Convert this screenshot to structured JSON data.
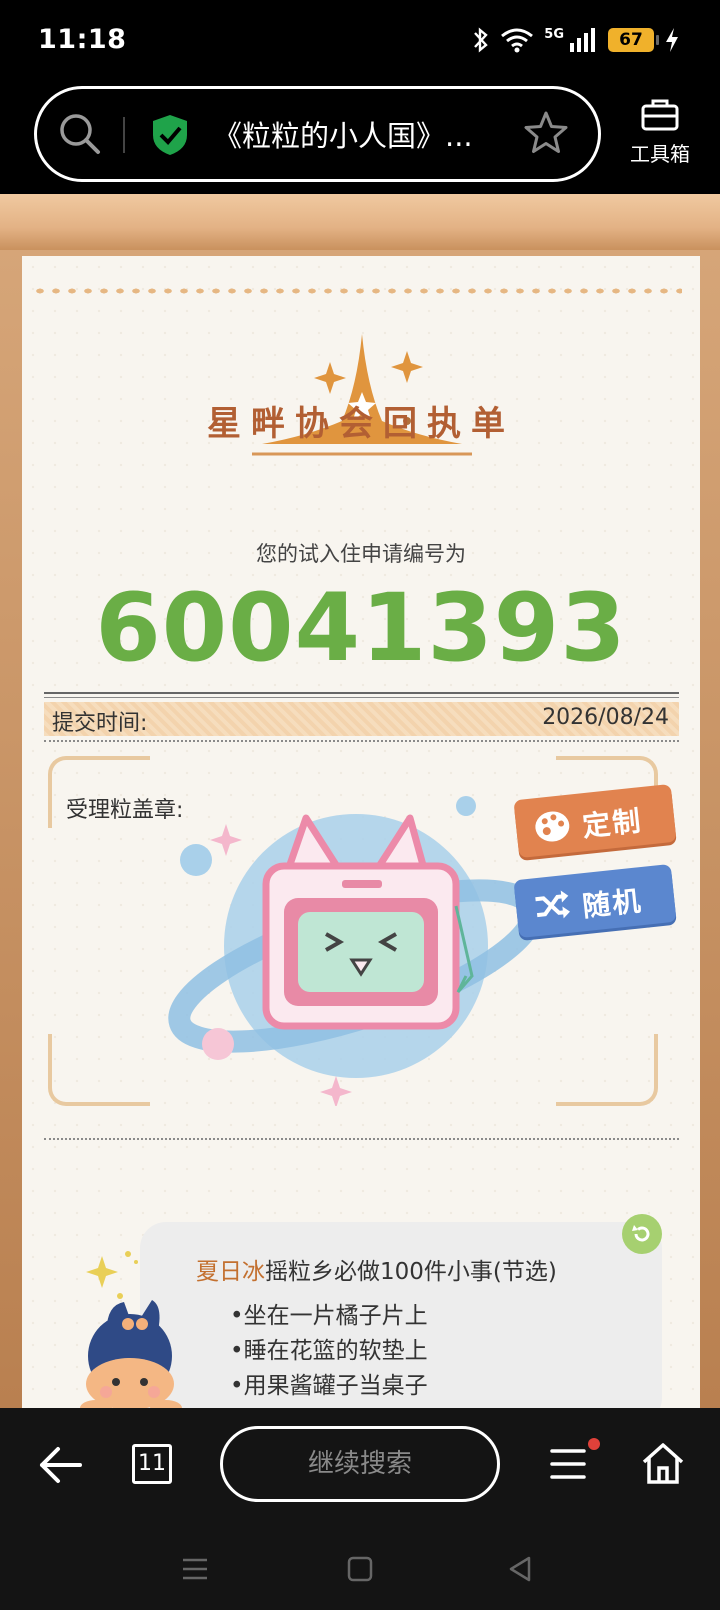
{
  "status_bar": {
    "time": "11:18",
    "network": "5G",
    "battery": "67"
  },
  "browser": {
    "url_title": "《粒粒的小人国》...",
    "toolbox_label": "工具箱",
    "security_color": "#1fa34a"
  },
  "receipt": {
    "logo_title": "星畔协会回执单",
    "subtitle": "您的试入住申请编号为",
    "application_number": "60041393",
    "submit_time_label": "提交时间:",
    "submit_time_value": "2026/08/24",
    "stamp_label": "受理粒盖章:",
    "custom_button": "定制",
    "random_button": "随机",
    "accent_color": "#6aae46"
  },
  "tips": {
    "highlight": "夏日冰",
    "title_rest": "摇粒乡必做100件小事(节选)",
    "items": [
      "•坐在一片橘子片上",
      "•睡在花篮的软垫上",
      "•用果酱罐子当桌子"
    ]
  },
  "bottom_nav": {
    "tab_count": "11",
    "continue_search": "继续搜索"
  }
}
